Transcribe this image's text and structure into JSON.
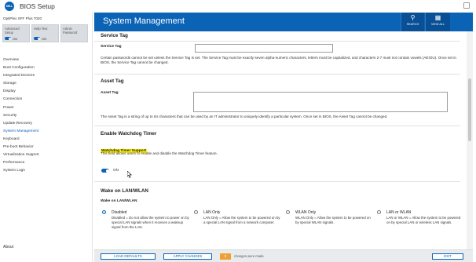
{
  "app": {
    "logo_text": "DELL",
    "title": "BIOS Setup"
  },
  "sidebar": {
    "model": "OptiPlex SFF Plus 7020",
    "quick": [
      {
        "label": "Advanced Setup",
        "toggle": "ON"
      },
      {
        "label": "Help Text",
        "toggle": "ON"
      },
      {
        "label": "Admin Password",
        "toggle": ""
      }
    ],
    "items": [
      "Overview",
      "Boot Configuration",
      "Integrated Devices",
      "Storage",
      "Display",
      "Connection",
      "Power",
      "Security",
      "Update,Recovery",
      "System Management",
      "Keyboard",
      "Pre-boot Behavior",
      "Virtualization Support",
      "Performance",
      "System Logs"
    ],
    "active_item": "System Management",
    "about": "About"
  },
  "header": {
    "title": "System Management",
    "search_label": "SEARCH",
    "view_all_label": "VIEW ALL"
  },
  "service_tag": {
    "section_title": "Service Tag",
    "field_label": "Service Tag",
    "value": "",
    "description": "Certain passwords cannot be set unless the Service Tag is set. The Service Tag must be exactly seven alpha-numeric characters, letters must be capitalized, and characters 2-7 must not contain vowels (AEIOU). Once set in BIOS, the Service Tag cannot be changed."
  },
  "asset_tag": {
    "section_title": "Asset Tag",
    "field_label": "Asset Tag",
    "value": "",
    "description": "The Asset Tag is a string of up to 64 characters that can be used by an IT administrator to uniquely identify a particular system. Once set in BIOS, the Asset Tag cannot be changed."
  },
  "watchdog": {
    "section_title": "Enable Watchdog Timer",
    "field_label": "Watchdog Timer Support",
    "description": "This field allows users to enable and disable the Watchdog Timer feature.",
    "toggle_label": "ON",
    "enabled": true
  },
  "wake_on_lan": {
    "section_title": "Wake on LAN/WLAN",
    "field_label": "Wake on LAN/WLAN",
    "selected": "Disabled",
    "options": [
      {
        "label": "Disabled",
        "description": "Disabled = Do not allow the system to power on by special LAN signals when it receives a wakeup signal from the LAN."
      },
      {
        "label": "LAN Only",
        "description": "LAN Only = Allow the system to be powered on by a special LAN signal from a network computer."
      },
      {
        "label": "WLAN Only",
        "description": "WLAN Only = Allow the system to be powered on by special WLAN signals."
      },
      {
        "label": "LAN or WLAN",
        "description": "LAN or WLAN = Allow the system to be powered on by special LAN or wireless LAN signals."
      }
    ]
  },
  "footer": {
    "load_defaults": "LOAD DEFAULTS",
    "apply_changes": "APPLY CHANGES",
    "changes_count": "0",
    "changes_text": "changes were made",
    "exit": "EXIT"
  },
  "colors": {
    "accent": "#0b63b6",
    "highlight": "#fff200",
    "changes_badge": "#f0a030"
  },
  "icons": {
    "search": "search-icon",
    "view_all": "grid-icon"
  }
}
